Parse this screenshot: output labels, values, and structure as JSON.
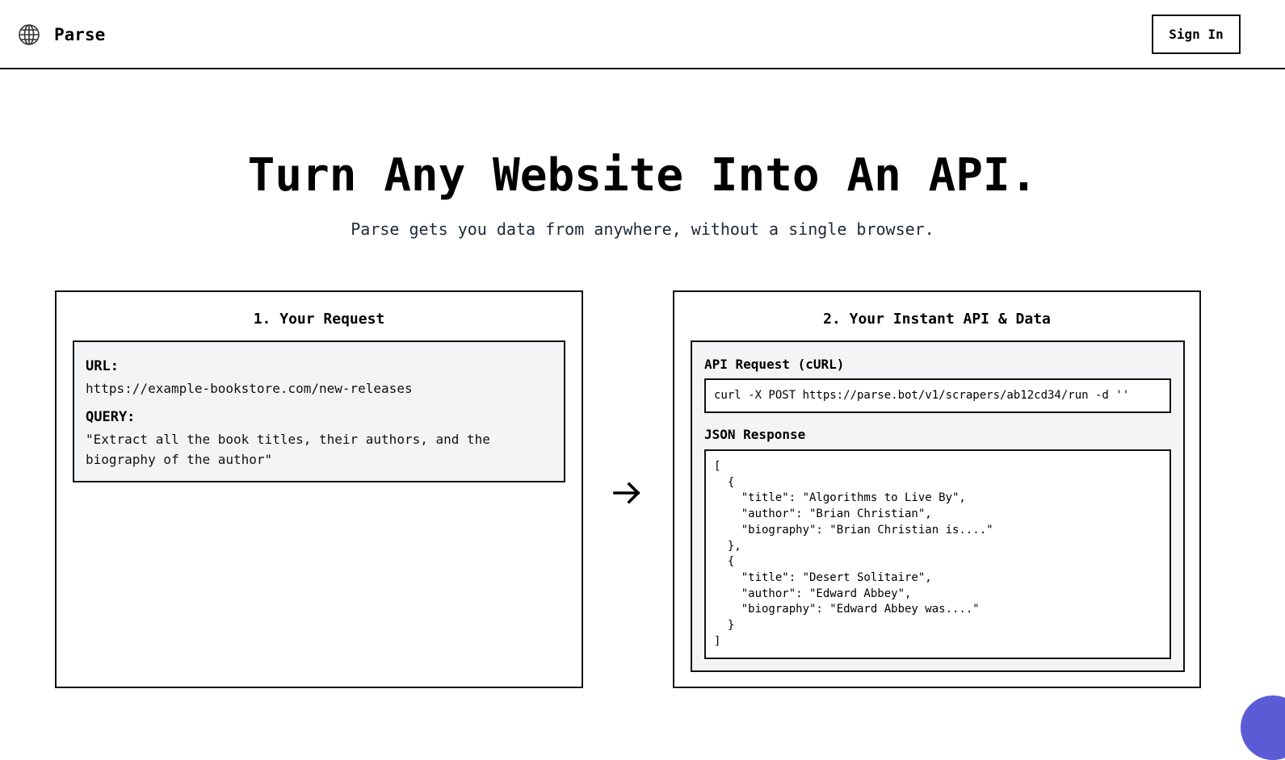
{
  "header": {
    "brand": "Parse",
    "logo_icon": "globe-icon",
    "sign_in_label": "Sign In"
  },
  "hero": {
    "title": "Turn Any Website Into An API.",
    "subtitle": "Parse gets you data from anywhere, without a single browser."
  },
  "request_panel": {
    "title": "1. Your Request",
    "url_label": "URL:",
    "url_value": "https://example-bookstore.com/new-releases",
    "query_label": "QUERY:",
    "query_value": "\"Extract all the book titles, their authors, and the biography of the author\""
  },
  "arrow_icon": "arrow-right-icon",
  "api_panel": {
    "title": "2. Your Instant API & Data",
    "curl_label": "API Request (cURL)",
    "curl_value": "curl -X POST https://parse.bot/v1/scrapers/ab12cd34/run -d ''",
    "json_label": "JSON Response",
    "json_value": "[\n  {\n    \"title\": \"Algorithms to Live By\",\n    \"author\": \"Brian Christian\",\n    \"biography\": \"Brian Christian is....\"\n  },\n  {\n    \"title\": \"Desert Solitaire\",\n    \"author\": \"Edward Abbey\",\n    \"biography\": \"Edward Abbey was....\"\n  }\n]"
  },
  "colors": {
    "border": "#111111",
    "panel_fill": "#f3f4f6",
    "chat_bubble": "#5b5bd6"
  }
}
